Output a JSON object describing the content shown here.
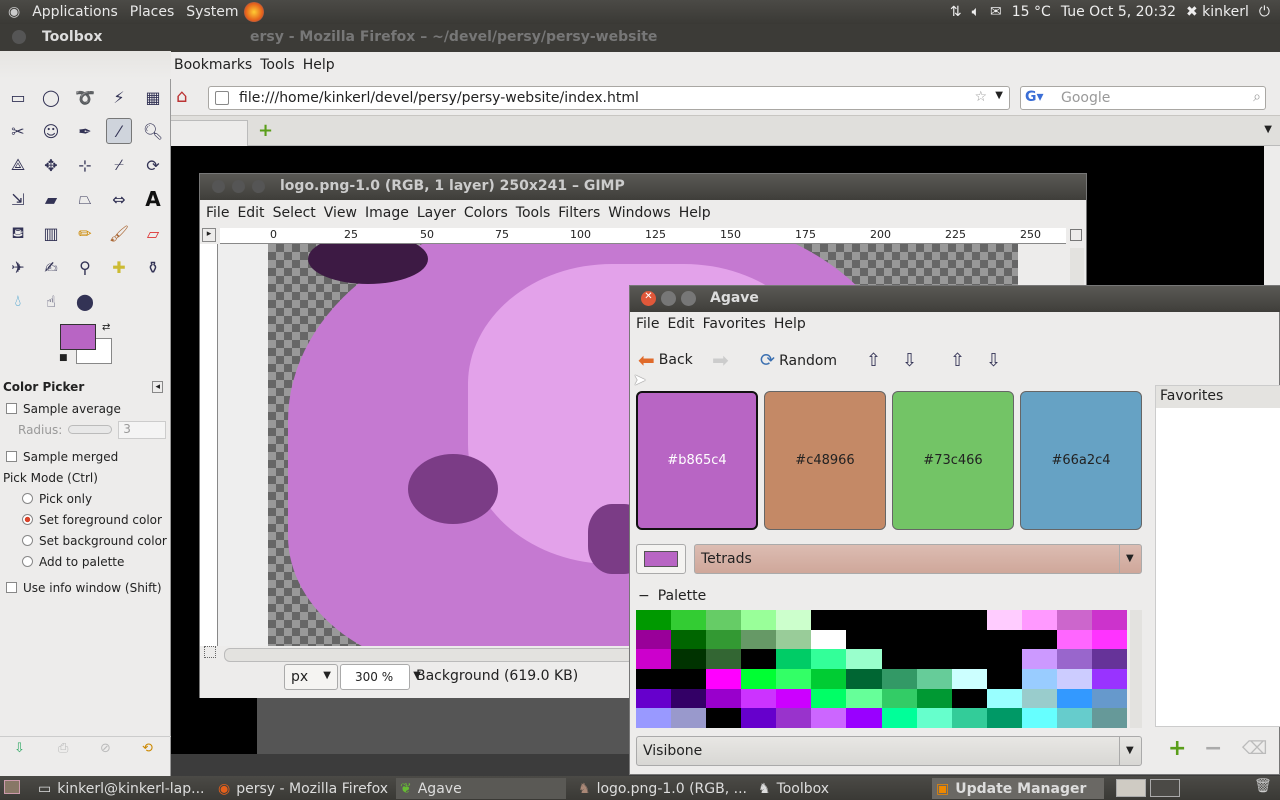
{
  "top_panel": {
    "menus": [
      "Applications",
      "Places",
      "System"
    ],
    "temperature": "15 °C",
    "datetime": "Tue Oct  5, 20:32",
    "user": "kinkerl"
  },
  "firefox": {
    "title": "persy - Mozilla Firefox",
    "title_fragment": "ersy - Mozilla Firefox  – ~/devel/persy/persy-website",
    "menus": [
      "Bookmarks",
      "Tools",
      "Help"
    ],
    "url": "file:///home/kinkerl/devel/persy/persy-website/index.html",
    "search_placeholder": "Google"
  },
  "gimp": {
    "title": "logo.png-1.0 (RGB, 1 layer) 250x241 – GIMP",
    "menus": [
      "File",
      "Edit",
      "Select",
      "View",
      "Image",
      "Layer",
      "Colors",
      "Tools",
      "Filters",
      "Windows",
      "Help"
    ],
    "ruler_ticks": [
      "0",
      "25",
      "50",
      "75",
      "100",
      "125",
      "150",
      "175",
      "200",
      "225",
      "250"
    ],
    "unit": "px",
    "zoom": "300 %",
    "status": "Background (619.0 KB)"
  },
  "toolbox": {
    "title": "Toolbox",
    "fg_color": "#b865c4",
    "bg_color": "#ffffff",
    "options": {
      "title": "Color Picker",
      "sample_average": "Sample average",
      "radius_label": "Radius:",
      "radius_value": "3",
      "sample_merged": "Sample merged",
      "pick_mode_label": "Pick Mode  (Ctrl)",
      "pick_modes": [
        "Pick only",
        "Set foreground color",
        "Set background color",
        "Add to palette"
      ],
      "selected_mode": 1,
      "use_info_window": "Use info window  (Shift)"
    }
  },
  "agave": {
    "title": "Agave",
    "menus": [
      "File",
      "Edit",
      "Favorites",
      "Help"
    ],
    "toolbar": {
      "back": "Back",
      "random": "Random"
    },
    "swatches": [
      {
        "label": "#b865c4",
        "color": "#b865c4",
        "text_color": "#ffffff"
      },
      {
        "label": "#c48966",
        "color": "#c48966",
        "text_color": "#111111"
      },
      {
        "label": "#73c466",
        "color": "#73c466",
        "text_color": "#111111"
      },
      {
        "label": "#66a2c4",
        "color": "#66a2c4",
        "text_color": "#111111"
      }
    ],
    "scheme": "Tetrads",
    "palette_label": "Palette",
    "palette_name": "Visibone",
    "favorites_label": "Favorites"
  },
  "taskbar": {
    "items": [
      "kinkerl@kinkerl-lap...",
      "persy - Mozilla Firefox",
      "Agave",
      "logo.png-1.0 (RGB, ...",
      "Toolbox",
      "Update Manager"
    ]
  }
}
